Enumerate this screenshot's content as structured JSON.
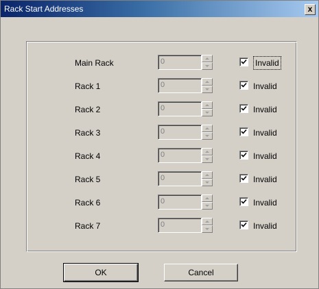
{
  "window": {
    "title": "Rack Start Addresses",
    "close_label": "x"
  },
  "rows": [
    {
      "label": "Main Rack",
      "value": "0",
      "checkbox_label": "Invalid",
      "checked": true
    },
    {
      "label": "Rack  1",
      "value": "0",
      "checkbox_label": "Invalid",
      "checked": true
    },
    {
      "label": "Rack  2",
      "value": "0",
      "checkbox_label": "Invalid",
      "checked": true
    },
    {
      "label": "Rack  3",
      "value": "0",
      "checkbox_label": "Invalid",
      "checked": true
    },
    {
      "label": "Rack  4",
      "value": "0",
      "checkbox_label": "Invalid",
      "checked": true
    },
    {
      "label": "Rack  5",
      "value": "0",
      "checkbox_label": "Invalid",
      "checked": true
    },
    {
      "label": "Rack  6",
      "value": "0",
      "checkbox_label": "Invalid",
      "checked": true
    },
    {
      "label": "Rack  7",
      "value": "0",
      "checkbox_label": "Invalid",
      "checked": true
    }
  ],
  "buttons": {
    "ok_label": "OK",
    "cancel_label": "Cancel"
  }
}
